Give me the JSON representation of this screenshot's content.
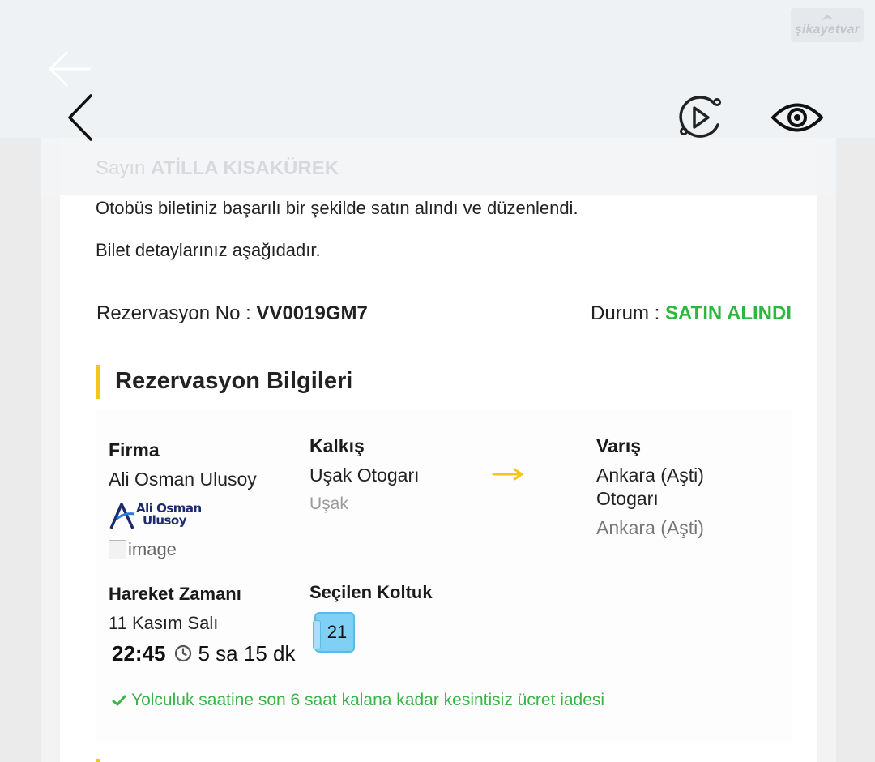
{
  "watermark": {
    "text": "şikayetvar"
  },
  "toolbar": {
    "back_icon": "chevron-left-icon",
    "play_icon": "play-circle-icon",
    "eye_icon": "eye-icon"
  },
  "greeting": {
    "prefix": "Sayın",
    "name": "ATİLLA KISAKÜREK"
  },
  "message": {
    "line1": "Otobüs biletiniz başarılı bir şekilde satın alındı ve düzenlendi.",
    "line2": "Bilet detaylarınız aşağıdadır."
  },
  "reservation": {
    "no_label": "Rezervasyon No : ",
    "no_value": "VV0019GM7",
    "status_label": "Durum : ",
    "status_value": "SATIN ALINDI"
  },
  "section": {
    "title": "Rezervasyon Bilgileri"
  },
  "firma": {
    "label": "Firma",
    "value": "Ali Osman Ulusoy",
    "logo_line1": "Ali Osman",
    "logo_line2": "Ulusoy",
    "image_alt": "image"
  },
  "kalkis": {
    "label": "Kalkış",
    "station": "Uşak Otogarı",
    "city": "Uşak"
  },
  "varis": {
    "label": "Varış",
    "station_line1": "Ankara (Aşti)",
    "station_line2": "Otogarı",
    "city": "Ankara (Aşti)"
  },
  "hareket": {
    "label": "Hareket Zamanı",
    "date": "11 Kasım Salı",
    "time": "22:45",
    "duration": "5 sa 15 dk"
  },
  "koltuk": {
    "label": "Seçilen Koltuk",
    "number": "21"
  },
  "refund": {
    "text": "Yolculuk saatine son 6 saat kalana kadar kesintisiz ücret iadesi"
  },
  "colors": {
    "status_green": "#2db83d",
    "accent_yellow": "#f5c518",
    "seat_blue": "#7fd0f4"
  }
}
